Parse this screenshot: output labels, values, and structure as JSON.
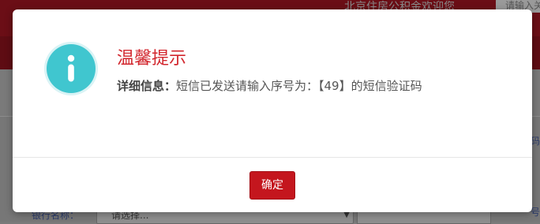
{
  "background": {
    "welcome_text": "北京住房公积金欢迎您",
    "top_button_text": "请输入关",
    "right_text_1": "码",
    "right_text_2": "号",
    "bottom_label": "银行名称：",
    "select_value": "请选择...",
    "colors": {
      "topbar": "#6b0e16",
      "redband": "#5e0c13"
    }
  },
  "dialog": {
    "icon": "info-icon",
    "title": "温馨提示",
    "detail_label": "详细信息：",
    "detail_message": "短信已发送请输入序号为：【49】的短信验证码",
    "confirm_label": "确定",
    "colors": {
      "title": "#d2262d",
      "icon_fill": "#40c6cf",
      "confirm_button": "#c4161e"
    }
  }
}
